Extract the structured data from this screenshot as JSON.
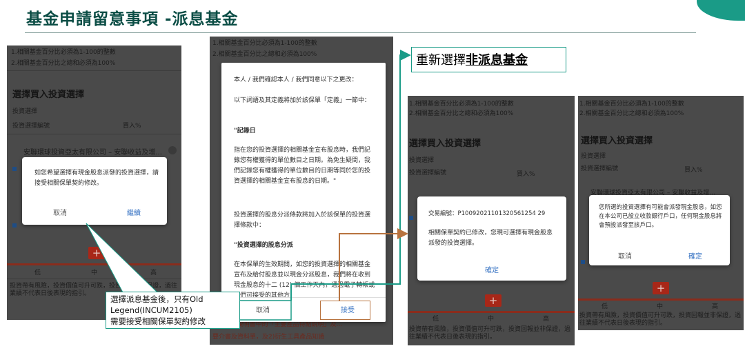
{
  "page": {
    "title": "基金申請留意事項 -派息基金"
  },
  "callout": {
    "prefix": "重新選擇",
    "emphasis": "非派息基金"
  },
  "note": {
    "lines": [
      "選擇派息基金後，只有Old",
      "Legend(INCUM2105)",
      "需要接受相關保單契約修改"
    ]
  },
  "screen1": {
    "rule1": "1.相關基金百分比必須為1-100的整數",
    "rule2": "2.相關基金百分比之總和必須為100%",
    "heading": "選擇買入投資選擇",
    "sub1": "投資選擇",
    "sub2": "投資選擇編號",
    "sub3": "買入%",
    "fund": "安聯環球投資亞太有限公司 – 安聯收益及增...",
    "risk_low": "低",
    "risk_mid": "中",
    "risk_high": "高",
    "footer": "投資帶有風險，投資價值可升可跌，投資回報並非保證，過往業績不代表日後表現的指引。",
    "dialog_text": "如您希望選擇有現金股息派發的投資選擇，請接受相關保單契約修改。",
    "cancel": "取消",
    "continue": "繼續"
  },
  "screen2": {
    "rule1": "1.相關基金百分比必須為1-100的整數",
    "rule2": "2.相關基金百分比之總和必須為100%",
    "p1": "本人 / 我們確認本人 / 我們同意以下之更改：",
    "p2": "以下詞語及其定義將加於該保單「定義」一節中：",
    "p3": "\"記錄日",
    "p4": "指在您的投資選擇的相關基金宣布股息時，我們記錄您有權獲得的單位數目之日期。為免生疑問，我們記錄您有權獲得的單位數目的日期等同於您的投資選擇的相關基金宣布股息的日期。\"",
    "p5": "投資選擇的股息分派條款將加入於該保單的投資選擇條款中：",
    "p6": "\"投資選擇的股息分派",
    "p7": "在本保單的生效期間，如您的投資選擇的相關基金宣布及給付股息並以現金分派股息，我們將在收到現金股息的十二 (12) 個工作天內，通過電子轉帳或我們可接受的其他方",
    "footer1": "...閱基金說明書中的「主要產品特點說明」及...",
    "footer2": "要介書及資料單，及2)衍生工具產品知識",
    "cancel": "取消",
    "accept": "接受"
  },
  "screen3": {
    "rule1": "1.相關基金百分比必須為1-100的整數",
    "rule2": "2.相關基金百分比之總和必須為100%",
    "heading": "選擇買入投資選擇",
    "sub1": "投資選擇",
    "sub2": "投資選擇編號",
    "sub3": "買入%",
    "tx_label": "交易編號：P10092021101320561254 29",
    "tx_text": "相關保單契約已修改，您現可選擇有現金股息派發的投資選擇。",
    "confirm": "確定",
    "risk_low": "低",
    "risk_mid": "中",
    "risk_high": "高",
    "footer": "投資帶有風險，投資價值可升可跌，投資回報並非保證，過往業績不代表日後表現的指引。"
  },
  "screen4": {
    "rule1": "1.相關基金百分比必須為1-100的整數",
    "rule2": "2.相關基金百分比之總和必須為100%",
    "heading": "選擇買入投資選擇",
    "sub1": "投資選擇",
    "sub2": "投資選擇編號",
    "sub3": "買入%",
    "fund": "安聯環球投資亞太有限公司 – 安聯收益及增...",
    "dialog_text": "您所選的投資選擇有可能會派發現金股息，如您在本公司已設立收款銀行戶口，任何現金股息將會預設派發至該戶口。",
    "cancel": "取消",
    "confirm": "確定",
    "risk_low": "低",
    "risk_mid": "中",
    "risk_high": "高",
    "footer": "投資帶有風險，投資價值可升可跌，投資回報並非保證，過往業績不代表日後表現的指引。"
  },
  "colors": {
    "title": "#0b4d45",
    "accent": "#1a9b87",
    "arrow": "#b8733f",
    "link": "#3a75c4"
  }
}
